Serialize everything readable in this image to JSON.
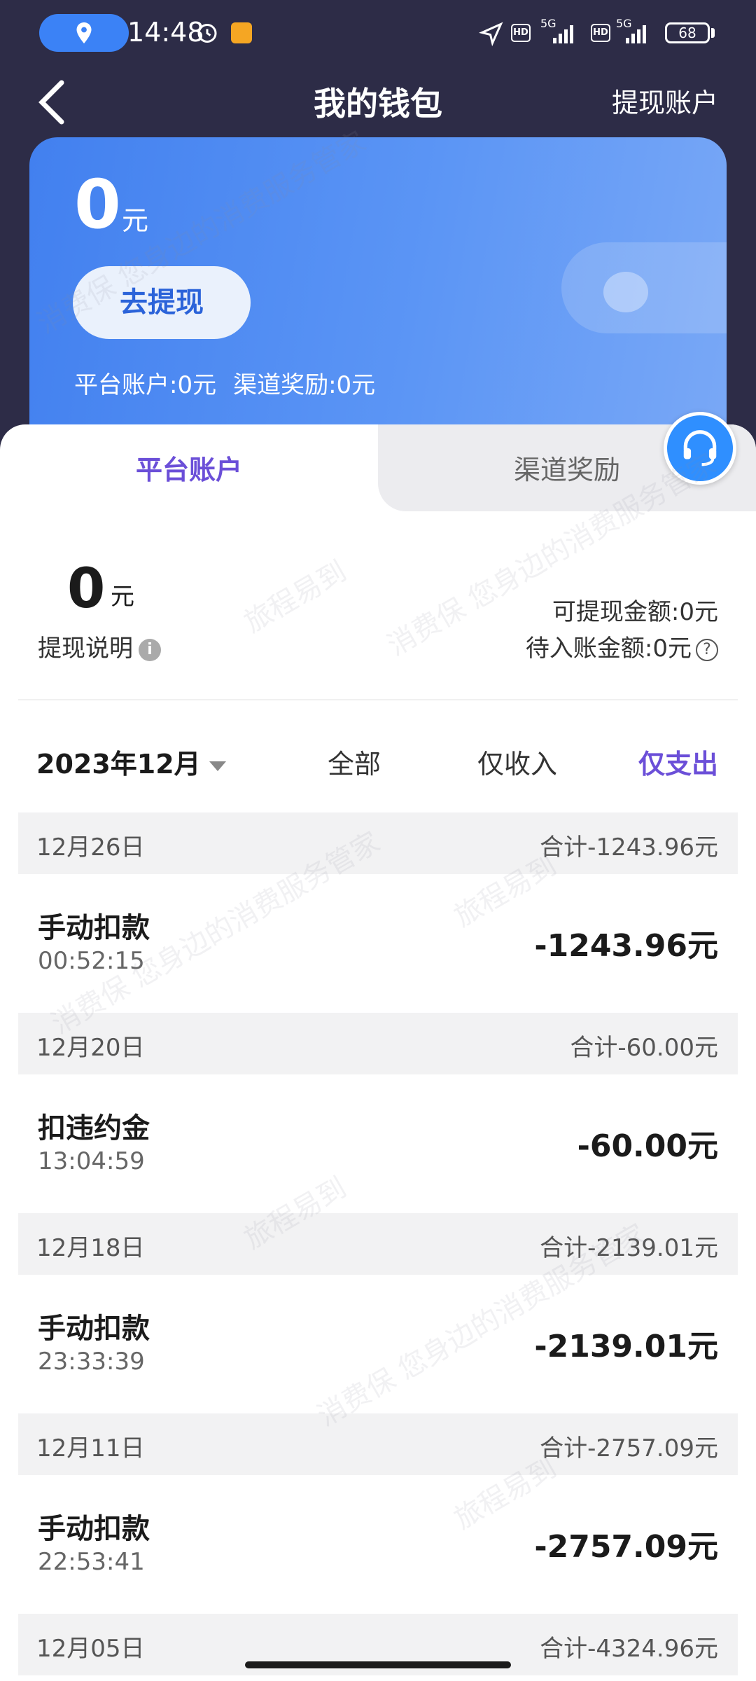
{
  "status_bar": {
    "time": "14:48",
    "battery": "68",
    "network_1": "5G",
    "network_2": "5G",
    "hd_label": "HD"
  },
  "header": {
    "title": "我的钱包",
    "action": "提现账户"
  },
  "card": {
    "amount": "0",
    "unit": "元",
    "withdraw_label": "去提现",
    "platform_account": "平台账户:0元",
    "channel_reward": "渠道奖励:0元"
  },
  "tabs": {
    "active": "平台账户",
    "inactive": "渠道奖励"
  },
  "account": {
    "amount": "0",
    "unit": "元",
    "explain": "提现说明",
    "available": "可提现金额:0元",
    "pending": "待入账金额:0元"
  },
  "filter": {
    "month": "2023年12月",
    "all": "全部",
    "income": "仅收入",
    "expense": "仅支出"
  },
  "days": [
    {
      "date": "12月26日",
      "total": "合计-1243.96元",
      "entry": {
        "title": "手动扣款",
        "time": "00:52:15",
        "amount": "-1243.96元"
      }
    },
    {
      "date": "12月20日",
      "total": "合计-60.00元",
      "entry": {
        "title": "扣违约金",
        "time": "13:04:59",
        "amount": "-60.00元"
      }
    },
    {
      "date": "12月18日",
      "total": "合计-2139.01元",
      "entry": {
        "title": "手动扣款",
        "time": "23:33:39",
        "amount": "-2139.01元"
      }
    },
    {
      "date": "12月11日",
      "total": "合计-2757.09元",
      "entry": {
        "title": "手动扣款",
        "time": "22:53:41",
        "amount": "-2757.09元"
      }
    },
    {
      "date": "12月05日",
      "total": "合计-4324.96元"
    }
  ],
  "watermark": {
    "text_1": "消费保 您身边的消费服务管家",
    "text_2": "旅程易到"
  },
  "colors": {
    "accent": "#6b4fd8",
    "card": "#4280ef",
    "header_bg": "#2d2c47"
  }
}
